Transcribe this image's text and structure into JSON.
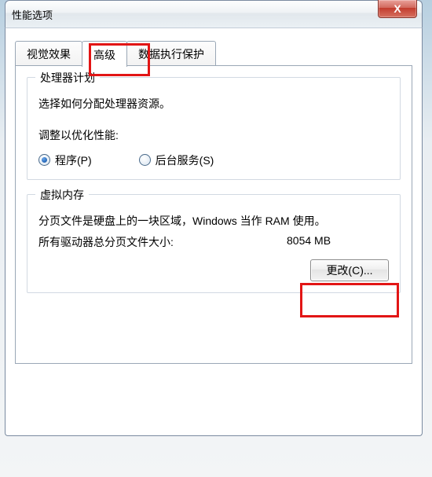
{
  "window": {
    "title": "性能选项",
    "close_symbol": "X"
  },
  "tabs": {
    "visual": "视觉效果",
    "advanced": "高级",
    "dep": "数据执行保护",
    "selected": "advanced"
  },
  "cpu_group": {
    "title": "处理器计划",
    "desc": "选择如何分配处理器资源。",
    "adjust_label": "调整以优化性能:",
    "opt_programs": "程序(P)",
    "opt_services": "后台服务(S)",
    "selected": "programs"
  },
  "vm_group": {
    "title": "虚拟内存",
    "desc": "分页文件是硬盘上的一块区域，Windows 当作 RAM 使用。",
    "total_label": "所有驱动器总分页文件大小:",
    "total_value": "8054 MB",
    "change_btn": "更改(C)..."
  }
}
